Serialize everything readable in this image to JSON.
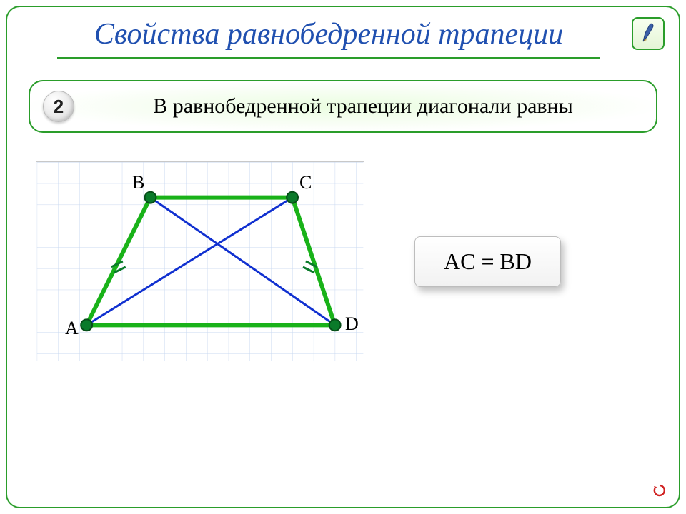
{
  "title": "Свойства равнобедренной трапеции",
  "badge_number": "2",
  "statement": "В равнобедренной трапеции диагонали равны",
  "equation": "AC = BD",
  "vertices": {
    "A": "A",
    "B": "B",
    "C": "C",
    "D": "D"
  },
  "colors": {
    "frame_green": "#2a9d2a",
    "title_blue": "#2050b0",
    "edge_green": "#19b219",
    "diagonal_blue": "#1030d0",
    "vertex_fill": "#0a7a2a"
  },
  "icons": {
    "pen": "pen-icon",
    "refresh": "refresh-icon"
  }
}
